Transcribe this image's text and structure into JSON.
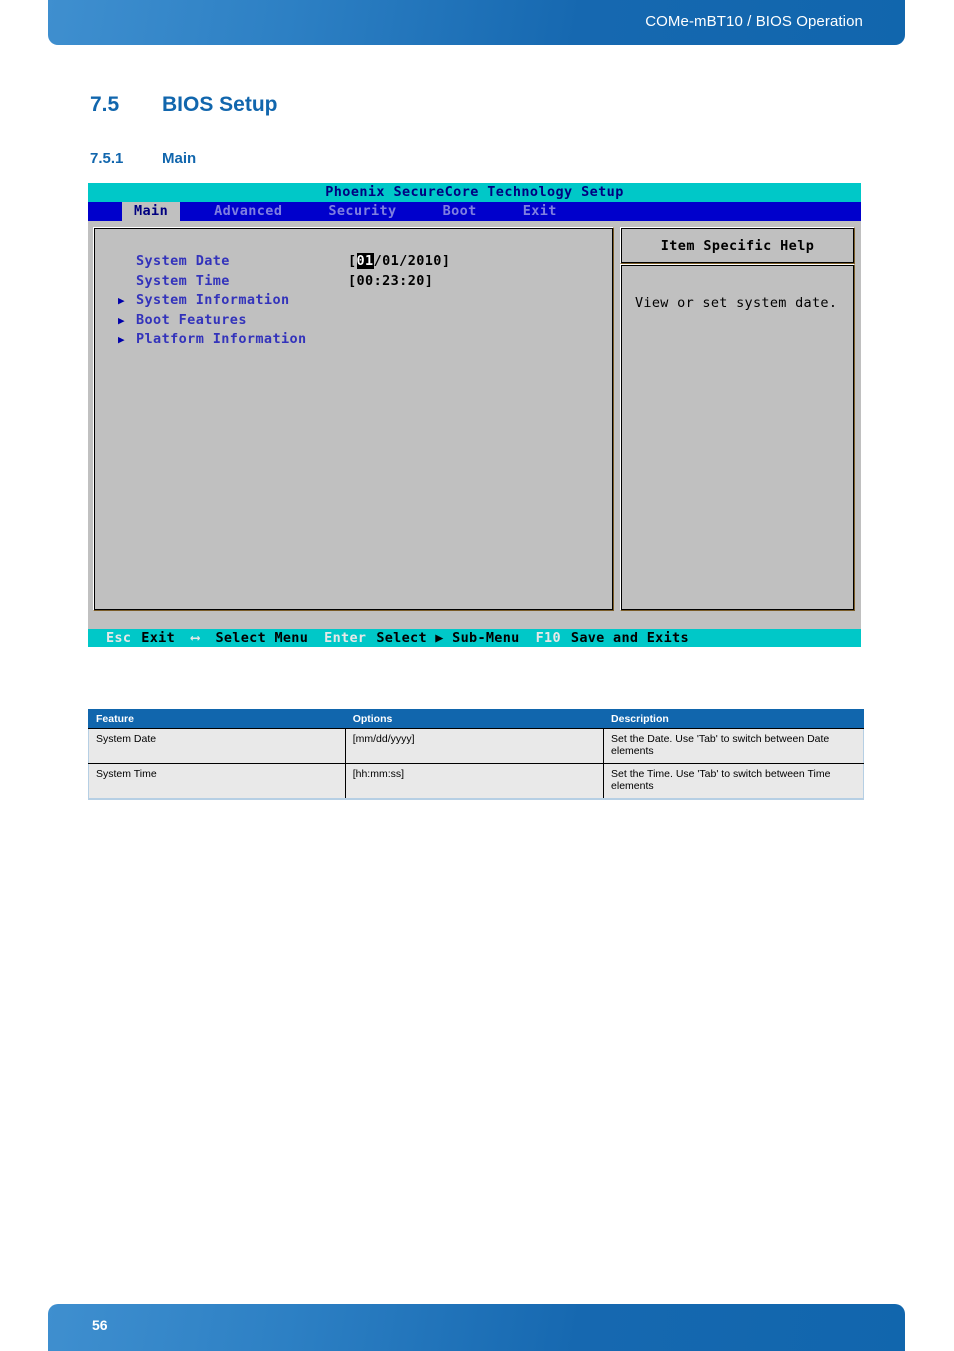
{
  "header": {
    "title": "COMe-mBT10 / BIOS Operation"
  },
  "headings": {
    "section_number": "7.5",
    "section_title": "BIOS Setup",
    "subsection_number": "7.5.1",
    "subsection_title": "Main"
  },
  "bios": {
    "title": "Phoenix SecureCore Technology Setup",
    "menu": [
      {
        "label": "Main",
        "active": true
      },
      {
        "label": "Advanced",
        "active": false
      },
      {
        "label": "Security",
        "active": false
      },
      {
        "label": "Boot",
        "active": false
      },
      {
        "label": "Exit",
        "active": false
      }
    ],
    "rows": [
      {
        "arrow": "",
        "label": "System Date",
        "value_pre": "[",
        "value_hl": "01",
        "value_post": "/01/2010]"
      },
      {
        "arrow": "",
        "label": "System Time",
        "value_pre": "[00:23:20]",
        "value_hl": "",
        "value_post": ""
      },
      {
        "arrow": "▶",
        "label": "System Information",
        "value_pre": "",
        "value_hl": "",
        "value_post": ""
      },
      {
        "arrow": "▶",
        "label": "Boot Features",
        "value_pre": "",
        "value_hl": "",
        "value_post": ""
      },
      {
        "arrow": "▶",
        "label": "Platform Information",
        "value_pre": "",
        "value_hl": "",
        "value_post": ""
      }
    ],
    "help": {
      "title": "Item Specific Help",
      "text": "View or set system date."
    },
    "status": {
      "esc_key": "Esc",
      "esc_label": "Exit",
      "arrows_key": "⟷",
      "arrows_label": "Select Menu",
      "enter_key": "Enter",
      "enter_label": "Select ▶ Sub-Menu",
      "f10_key": "F10",
      "f10_label": "Save and Exits"
    }
  },
  "table": {
    "headers": {
      "feature": "Feature",
      "options": "Options",
      "description": "Description"
    },
    "rows": [
      {
        "feature": "System Date",
        "options": "[mm/dd/yyyy]",
        "description": "Set the Date. Use 'Tab' to switch between Date elements"
      },
      {
        "feature": "System Time",
        "options": "[hh:mm:ss]",
        "description": "Set the Time. Use 'Tab' to switch between Time elements"
      }
    ]
  },
  "footer": {
    "page_number": "56"
  },
  "colors": {
    "brand_blue": "#1166ad",
    "bios_cyan": "#00c8c8",
    "bios_menu_blue": "#0000cc",
    "bios_grey": "#c0c0c0"
  }
}
